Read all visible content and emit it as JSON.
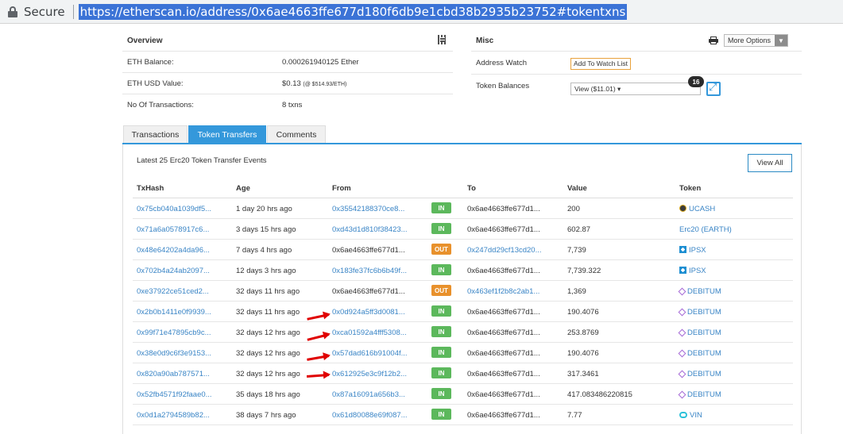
{
  "browser": {
    "secure_label": "Secure",
    "url": "https://etherscan.io/address/0x6ae4663ffe677d180f6db9e1cbd38b2935b23752#tokentxns"
  },
  "overview": {
    "title": "Overview",
    "rows": [
      {
        "label": "ETH Balance:",
        "value": "0.000261940125 Ether",
        "extra": ""
      },
      {
        "label": "ETH USD Value:",
        "value": "$0.13",
        "extra": "(@ $514.93/ETH)"
      },
      {
        "label": "No Of Transactions:",
        "value": "8 txns",
        "extra": ""
      }
    ]
  },
  "misc": {
    "title": "Misc",
    "more_options": "More Options",
    "address_watch_label": "Address Watch",
    "add_watch_button": "Add To Watch List",
    "token_balances_label": "Token Balances",
    "token_select_value": "View ($11.01) ▾",
    "token_count": "16"
  },
  "tabs": [
    {
      "label": "Transactions",
      "active": false
    },
    {
      "label": "Token Transfers",
      "active": true
    },
    {
      "label": "Comments",
      "active": false
    }
  ],
  "transfers": {
    "heading": "Latest 25 Erc20 Token Transfer Events",
    "view_all": "View All",
    "columns": [
      "TxHash",
      "Age",
      "From",
      "",
      "To",
      "Value",
      "Token"
    ],
    "rows": [
      {
        "hash": "0x75cb040a1039df5...",
        "age": "1 day 20 hrs ago",
        "from": "0x35542188370ce8...",
        "from_link": true,
        "dir": "IN",
        "to": "0x6ae4663ffe677d1...",
        "to_link": false,
        "value": "200",
        "token": "UCASH",
        "icon": "ucash"
      },
      {
        "hash": "0x71a6a0578917c6...",
        "age": "3 days 15 hrs ago",
        "from": "0xd43d1d810f38423...",
        "from_link": true,
        "dir": "IN",
        "to": "0x6ae4663ffe677d1...",
        "to_link": false,
        "value": "602.87",
        "token": "Erc20 (EARTH)",
        "icon": ""
      },
      {
        "hash": "0x48e64202a4da96...",
        "age": "7 days 4 hrs ago",
        "from": "0x6ae4663ffe677d1...",
        "from_link": false,
        "dir": "OUT",
        "to": "0x247dd29cf13cd20...",
        "to_link": true,
        "value": "7,739",
        "token": "IPSX",
        "icon": "ipsx"
      },
      {
        "hash": "0x702b4a24ab2097...",
        "age": "12 days 3 hrs ago",
        "from": "0x183fe37fc6b6b49f...",
        "from_link": true,
        "dir": "IN",
        "to": "0x6ae4663ffe677d1...",
        "to_link": false,
        "value": "7,739.322",
        "token": "IPSX",
        "icon": "ipsx"
      },
      {
        "hash": "0xe37922ce51ced2...",
        "age": "32 days 11 hrs ago",
        "from": "0x6ae4663ffe677d1...",
        "from_link": false,
        "dir": "OUT",
        "to": "0x463ef1f2b8c2ab1...",
        "to_link": true,
        "value": "1,369",
        "token": "DEBITUM",
        "icon": "debitum"
      },
      {
        "hash": "0x2b0b1411e0f9939...",
        "age": "32 days 11 hrs ago",
        "from": "0x0d924a5ff3d0081...",
        "from_link": true,
        "dir": "IN",
        "to": "0x6ae4663ffe677d1...",
        "to_link": false,
        "value": "190.4076",
        "token": "DEBITUM",
        "icon": "debitum"
      },
      {
        "hash": "0x99f71e47895cb9c...",
        "age": "32 days 12 hrs ago",
        "from": "0xca01592a4fff5308...",
        "from_link": true,
        "dir": "IN",
        "to": "0x6ae4663ffe677d1...",
        "to_link": false,
        "value": "253.8769",
        "token": "DEBITUM",
        "icon": "debitum"
      },
      {
        "hash": "0x38e0d9c6f3e9153...",
        "age": "32 days 12 hrs ago",
        "from": "0x57dad616b91004f...",
        "from_link": true,
        "dir": "IN",
        "to": "0x6ae4663ffe677d1...",
        "to_link": false,
        "value": "190.4076",
        "token": "DEBITUM",
        "icon": "debitum"
      },
      {
        "hash": "0x820a90ab787571...",
        "age": "32 days 12 hrs ago",
        "from": "0x612925e3c9f12b2...",
        "from_link": true,
        "dir": "IN",
        "to": "0x6ae4663ffe677d1...",
        "to_link": false,
        "value": "317.3461",
        "token": "DEBITUM",
        "icon": "debitum"
      },
      {
        "hash": "0x52fb4571f92faae0...",
        "age": "35 days 18 hrs ago",
        "from": "0x87a16091a656b3...",
        "from_link": true,
        "dir": "IN",
        "to": "0x6ae4663ffe677d1...",
        "to_link": false,
        "value": "417.083486220815",
        "token": "DEBITUM",
        "icon": "debitum"
      },
      {
        "hash": "0x0d1a2794589b82...",
        "age": "38 days 7 hrs ago",
        "from": "0x61d80088e69f087...",
        "from_link": true,
        "dir": "IN",
        "to": "0x6ae4663ffe677d1...",
        "to_link": false,
        "value": "7.77",
        "token": "VIN",
        "icon": "vin"
      }
    ]
  },
  "colors": {
    "link": "#3a85c6",
    "in_badge": "#5cb85c",
    "out_badge": "#e8912c",
    "tab_active": "#3498db",
    "annotation_arrow": "#e00000"
  }
}
